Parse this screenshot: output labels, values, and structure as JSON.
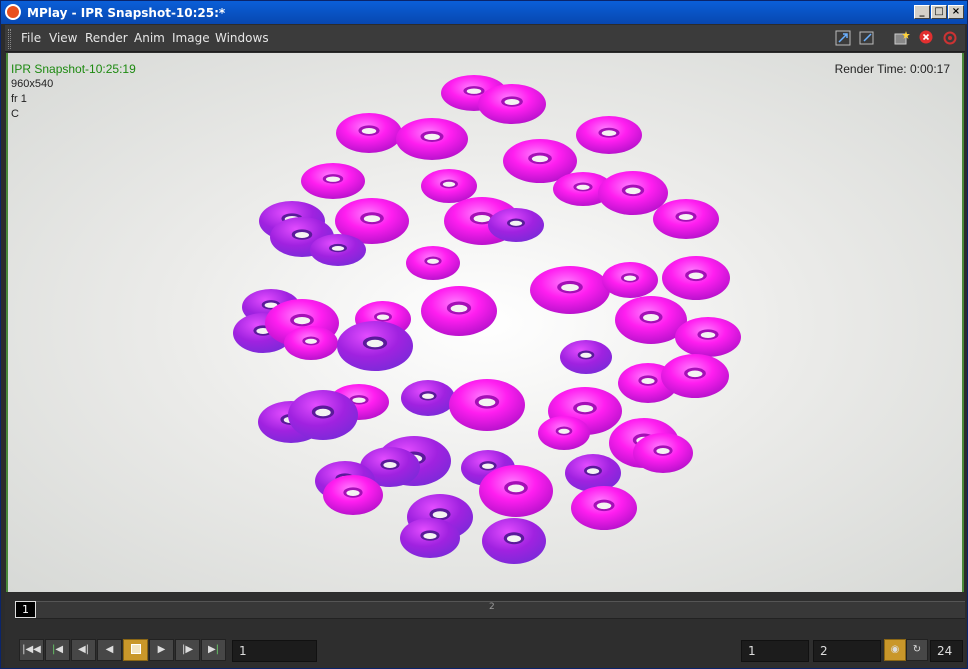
{
  "window": {
    "title": "MPlay - IPR Snapshot-10:25:*"
  },
  "menu": [
    "File",
    "View",
    "Render",
    "Anim",
    "Image",
    "Windows"
  ],
  "overlay": {
    "snapshot_name": "IPR Snapshot-10:25:19",
    "resolution": "960x540",
    "frame": "fr 1",
    "channel": "C",
    "render_time": "Render Time: 0:00:17"
  },
  "timeline": {
    "current_frame_marker": "1",
    "tick_label": "2"
  },
  "controls": {
    "current_frame": "1",
    "range_start": "1",
    "range_end": "2",
    "fps": "24"
  },
  "colors": {
    "torus_main": "#ff1ef0",
    "torus_shadow": "#7a2ad8",
    "highlight_green": "#1d8a10"
  }
}
